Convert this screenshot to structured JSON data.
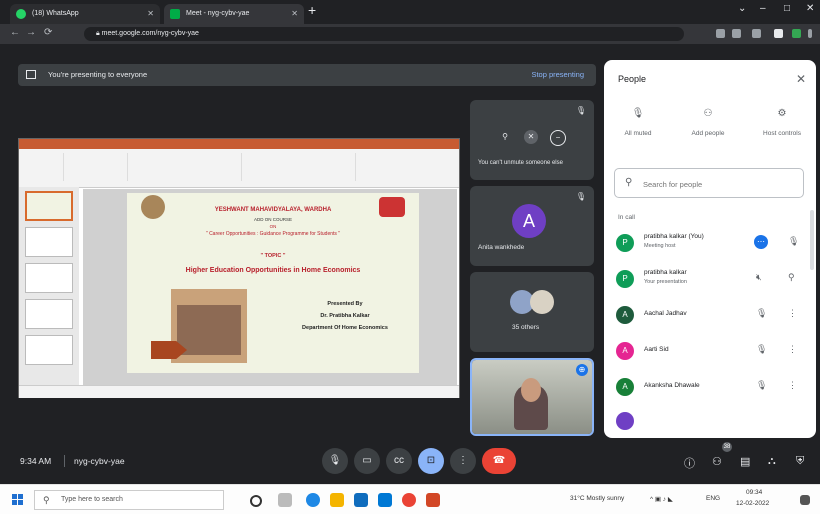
{
  "browser": {
    "tabs": [
      {
        "label": "(18) WhatsApp",
        "icon": "whatsapp-icon",
        "color": "#25d366"
      },
      {
        "label": "Meet - nyg-cybv-yae",
        "icon": "meet-icon",
        "color": "#00ac47"
      }
    ],
    "url": "meet.google.com/nyg-cybv-yae"
  },
  "meet": {
    "presenting_text": "You're presenting to everyone",
    "stop_presenting": "Stop presenting",
    "slide": {
      "line1": "YESHWANT MAHAVIDYALAYA, WARDHA",
      "line2": "ADD ON COURSE",
      "line3": "ON",
      "line4": "\" Career Opportunities : Guidance Programme for Students \"",
      "topic": "\" TOPIC \"",
      "heading": "Higher Education Opportunities in Home Economics",
      "presented_by": "Presented By",
      "presenter": "Dr. Pratibha Kalkar",
      "department": "Department Of Home Economics"
    },
    "tiles": {
      "cant_unmute": "You can't unmute someone else",
      "anita": "Anita wankhede",
      "anita_initial": "A",
      "others": "35 others"
    },
    "bottom": {
      "time": "9:34 AM",
      "meeting_code": "nyg-cybv-yae",
      "people_count": "38"
    },
    "accent": "#8ab4f8",
    "leave_color": "#ea4335"
  },
  "people": {
    "title": "People",
    "actions": [
      {
        "label": "All muted",
        "icon": "mic-off-icon"
      },
      {
        "label": "Add people",
        "icon": "add-person-icon"
      },
      {
        "label": "Host controls",
        "icon": "host-controls-icon"
      }
    ],
    "search_placeholder": "Search for people",
    "in_call": "In call",
    "participants": [
      {
        "name": "pratibha kalkar (You)",
        "sub": "Meeting host",
        "initial": "P",
        "color": "#0f9d58"
      },
      {
        "name": "pratibha kalkar",
        "sub": "Your presentation",
        "initial": "P",
        "color": "#0f9d58"
      },
      {
        "name": "Aachal Jadhav",
        "sub": "",
        "initial": "A",
        "color": "#1e5b3c"
      },
      {
        "name": "Aarti Sid",
        "sub": "",
        "initial": "A",
        "color": "#e52592"
      },
      {
        "name": "Akanksha Dhawale",
        "sub": "",
        "initial": "A",
        "color": "#188038"
      }
    ]
  },
  "taskbar": {
    "search_placeholder": "Type here to search",
    "weather": "31°C Mostly sunny",
    "lang": "ENG",
    "clock_time": "09:34",
    "clock_date": "12-02-2022"
  }
}
